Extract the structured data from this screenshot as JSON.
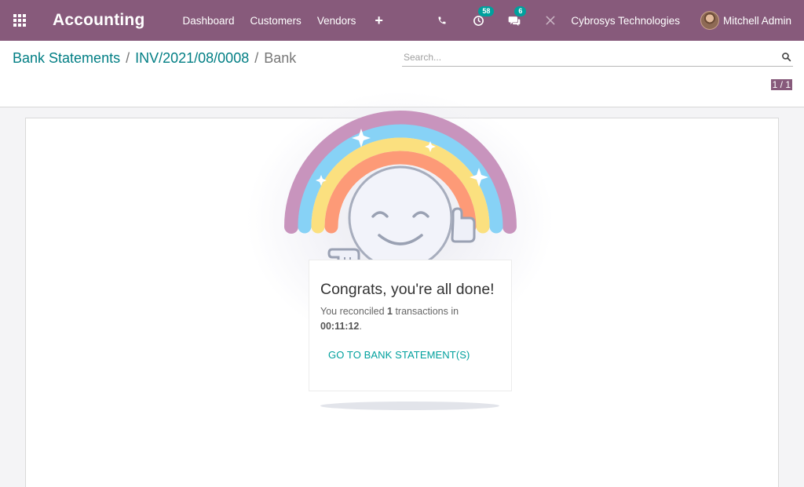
{
  "navbar": {
    "app_title": "Accounting",
    "menu": [
      "Dashboard",
      "Customers",
      "Vendors"
    ],
    "plus_label": "+",
    "activity_count": "58",
    "messages_count": "6",
    "company": "Cybrosys Technologies",
    "user": "Mitchell Admin",
    "bg_color": "#875a7b"
  },
  "breadcrumb": {
    "items": [
      "Bank Statements",
      "INV/2021/08/0008"
    ],
    "separator": "/",
    "current": "Bank"
  },
  "search": {
    "placeholder": "Search..."
  },
  "pager": {
    "value": "1 / 1"
  },
  "done": {
    "title": "Congrats, you're all done!",
    "text_prefix": "You reconciled ",
    "count": "1",
    "text_middle": " transactions in",
    "duration": "00:11:12",
    "text_suffix": ".",
    "link": "GO TO BANK STATEMENT(S)",
    "link_color": "#00a09d"
  }
}
